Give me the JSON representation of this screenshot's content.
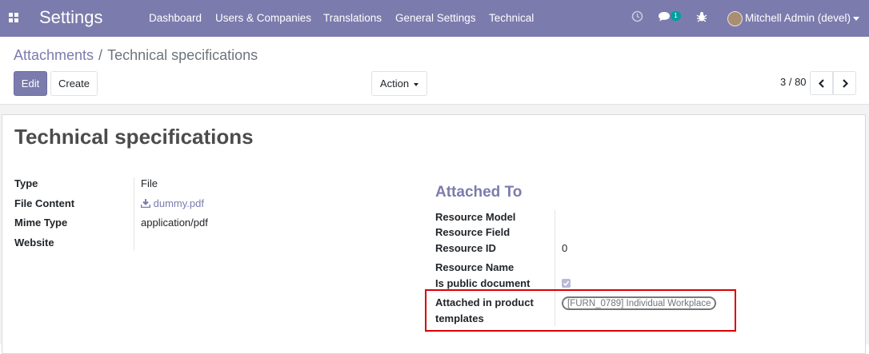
{
  "navbar": {
    "app_name": "Settings",
    "menu": [
      "Dashboard",
      "Users & Companies",
      "Translations",
      "General Settings",
      "Technical"
    ],
    "chat_badge": "1",
    "user": "Mitchell Admin (devel)",
    "icons": [
      "apps-grid-icon",
      "clock-icon",
      "chat-icon",
      "bug-icon",
      "user-avatar",
      "chevron-down-icon"
    ]
  },
  "breadcrumb": {
    "parent": "Attachments",
    "separator": "/",
    "current": "Technical specifications"
  },
  "buttons": {
    "edit": "Edit",
    "create": "Create",
    "action": "Action"
  },
  "pager": {
    "value": "3 / 80"
  },
  "record": {
    "title": "Technical specifications",
    "fields": [
      {
        "label": "Type",
        "value": "File"
      },
      {
        "label": "File Content",
        "value": "dummy.pdf"
      },
      {
        "label": "Mime Type",
        "value": "application/pdf"
      },
      {
        "label": "Website",
        "value": ""
      }
    ]
  },
  "attached_to": {
    "title": "Attached To",
    "fields": [
      {
        "label": "Resource Model",
        "value": ""
      },
      {
        "label": "Resource Field",
        "value": ""
      },
      {
        "label": "Resource ID",
        "value": "0"
      },
      {
        "label": "Resource Name",
        "value": ""
      },
      {
        "label": "Is public document",
        "value": "",
        "checked": true
      }
    ],
    "product_templates": {
      "label_line1": "Attached in product",
      "label_line2": "templates",
      "tag": "[FURN_0789] Individual Workplace"
    }
  },
  "colors": {
    "navbar": "#7c7bad",
    "primary": "#7c7bad",
    "highlight_border": "#d70000"
  }
}
